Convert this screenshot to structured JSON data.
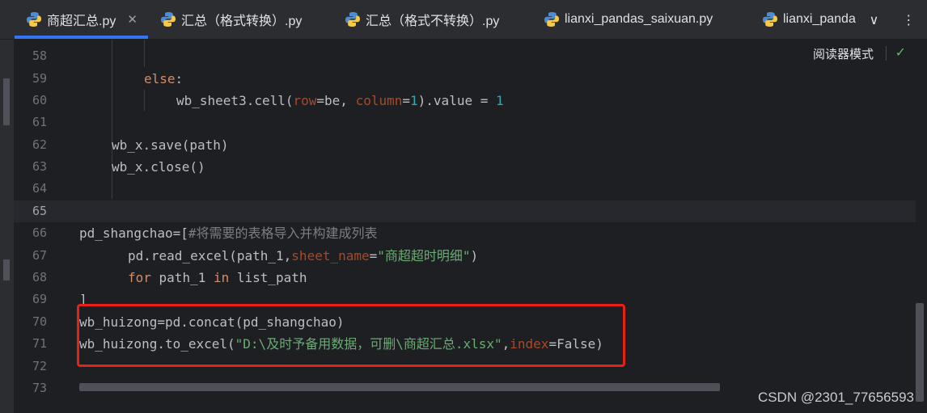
{
  "tabs": [
    {
      "label": "商超汇总.py",
      "active": true,
      "closable": true,
      "icon": "python-icon"
    },
    {
      "label": "汇总（格式转换）.py",
      "active": false,
      "icon": "python-icon"
    },
    {
      "label": "汇总（格式不转换）.py",
      "active": false,
      "icon": "python-icon"
    },
    {
      "label": "lianxi_pandas_saixuan.py",
      "active": false,
      "icon": "python-icon"
    },
    {
      "label": "lianxi_panda",
      "active": false,
      "icon": "python-icon"
    }
  ],
  "tab_actions": {
    "more_tabs": "∨",
    "menu": "⋮"
  },
  "editor": {
    "reader_mode": "阅读器模式",
    "check_icon": "✓",
    "current_line": 65,
    "line_numbers": [
      "58",
      "59",
      "60",
      "61",
      "62",
      "63",
      "64",
      "65",
      "66",
      "67",
      "68",
      "69",
      "70",
      "71",
      "72",
      "73"
    ],
    "code": {
      "l59": {
        "kw": "else",
        "rest": ":"
      },
      "l60": {
        "a": "wb_sheet3.cell(",
        "p1": "row",
        "b": "=be, ",
        "p2": "column",
        "c": "=",
        "n1": "1",
        "d": ").value = ",
        "n2": "1"
      },
      "l62": "wb_x.save(path)",
      "l63": "wb_x.close()",
      "l66": {
        "a": "pd_shangchao=[",
        "comment": "#将需要的表格导入并构建成列表"
      },
      "l67": {
        "a": "pd.read_excel(path_1,",
        "p": "sheet_name",
        "b": "=",
        "s": "\"商超超时明细\"",
        "c": ")"
      },
      "l68": {
        "kw1": "for",
        "a": " path_1 ",
        "kw2": "in",
        "b": " list_path"
      },
      "l69": "]",
      "l70": "wb_huizong=pd.concat(pd_shangchao)",
      "l71": {
        "a": "wb_huizong.to_excel(",
        "s": "\"D:\\及时予备用数据，可删\\商超汇总.xlsx\"",
        "b": ",",
        "p": "index",
        "c": "=False)"
      }
    }
  },
  "watermark": "CSDN @2301_77656593",
  "colors": {
    "accent": "#3574f0",
    "highlight_box": "#e8201a"
  }
}
